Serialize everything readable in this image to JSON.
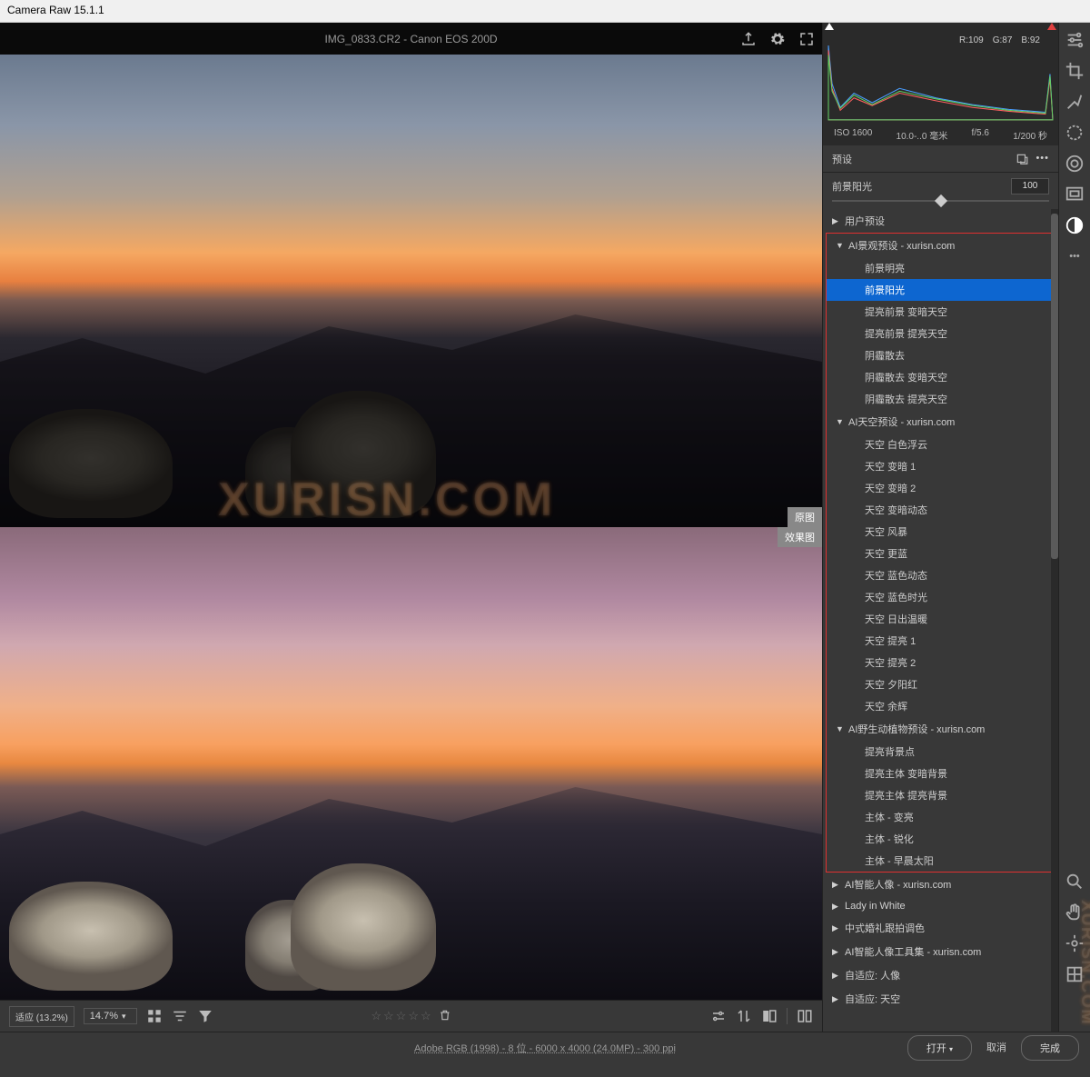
{
  "app_title": "Camera Raw 15.1.1",
  "file": {
    "name": "IMG_0833.CR2",
    "camera": "Canon EOS 200D"
  },
  "histogram": {
    "rgb": {
      "r": "R:109",
      "g": "G:87",
      "b": "B:92"
    },
    "exif": {
      "iso": "ISO 1600",
      "focal": "10.0-..0 毫米",
      "aperture": "f/5.6",
      "shutter": "1/200 秒"
    }
  },
  "panel": {
    "title": "预设",
    "slider_label": "前景阳光",
    "slider_value": "100"
  },
  "preview": {
    "label_original": "原图",
    "label_result": "效果图"
  },
  "presets": {
    "user_header": "用户预设",
    "groups": [
      {
        "name": "AI景观预设 - xurisn.com",
        "items": [
          "前景明亮",
          "前景阳光",
          "提亮前景 变暗天空",
          "提亮前景 提亮天空",
          "阴霾散去",
          "阴霾散去 变暗天空",
          "阴霾散去 提亮天空"
        ],
        "selected_index": 1
      },
      {
        "name": "AI天空预设 - xurisn.com",
        "items": [
          "天空 白色浮云",
          "天空 变暗 1",
          "天空 变暗 2",
          "天空 变暗动态",
          "天空 风暴",
          "天空 更蓝",
          "天空 蓝色动态",
          "天空 蓝色时光",
          "天空 日出温暖",
          "天空 提亮 1",
          "天空 提亮 2",
          "天空 夕阳红",
          "天空 余辉"
        ]
      },
      {
        "name": "AI野生动植物预设 - xurisn.com",
        "items": [
          "提亮背景点",
          "提亮主体 变暗背景",
          "提亮主体 提亮背景",
          "主体 - 变亮",
          "主体 - 锐化",
          "主体 - 早晨太阳"
        ]
      }
    ],
    "collapsed": [
      "AI智能人像 - xurisn.com",
      "Lady in White",
      "中式婚礼跟拍调色",
      "AI智能人像工具集 - xurisn.com",
      "自适应: 人像",
      "自适应: 天空"
    ]
  },
  "bottom": {
    "zoom_fit": "适应 (13.2%)",
    "zoom_value": "14.7%"
  },
  "footer": {
    "info": "Adobe RGB (1998) - 8 位 - 6000 x 4000 (24.0MP) - 300 ppi",
    "open": "打开",
    "cancel": "取消",
    "done": "完成"
  },
  "watermark": "XURISN.COM"
}
